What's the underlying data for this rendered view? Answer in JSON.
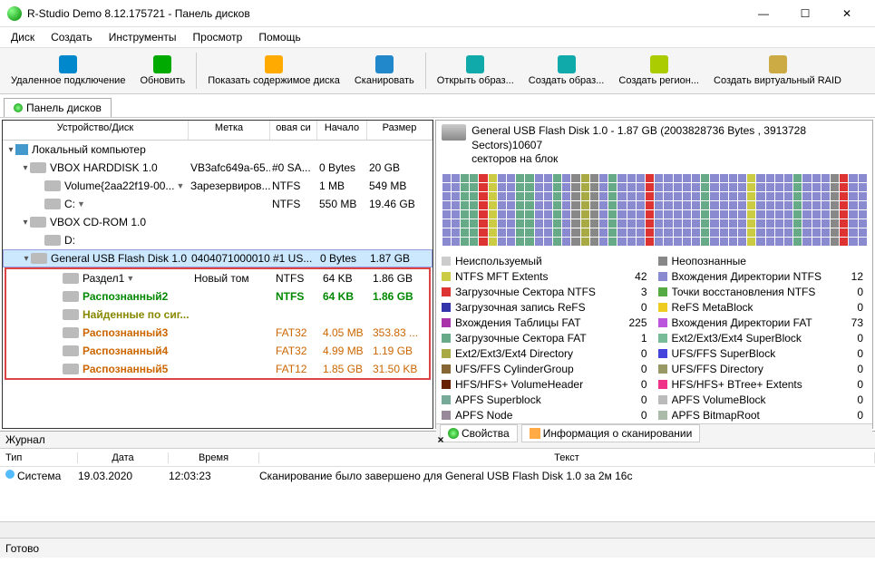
{
  "title": "R-Studio Demo 8.12.175721 - Панель дисков",
  "menu": [
    "Диск",
    "Создать",
    "Инструменты",
    "Просмотр",
    "Помощь"
  ],
  "toolbar": [
    {
      "label": "Удаленное подключение",
      "icon": "#08c"
    },
    {
      "label": "Обновить",
      "icon": "#0a0"
    },
    {
      "label": "Показать содержимое диска",
      "icon": "#fa0",
      "sep": true
    },
    {
      "label": "Сканировать",
      "icon": "#28c"
    },
    {
      "label": "Открыть образ...",
      "icon": "#1aa",
      "sep": true
    },
    {
      "label": "Создать образ...",
      "icon": "#1aa"
    },
    {
      "label": "Создать регион...",
      "icon": "#ac0"
    },
    {
      "label": "Создать виртуальный RAID",
      "icon": "#ca4"
    }
  ],
  "tabname": "Панель дисков",
  "cols": {
    "c1": "Устройство/Диск",
    "c2": "Метка",
    "c3": "овая си",
    "c4": "Начало",
    "c5": "Размер"
  },
  "tree": [
    {
      "ind": 0,
      "tri": "open",
      "ico": "comp",
      "name": "Локальный компьютер"
    },
    {
      "ind": 1,
      "tri": "open",
      "ico": "disk",
      "name": "VBOX HARDDISK 1.0",
      "c2": "VB3afc649a-65...",
      "c3": "#0 SA...",
      "c4": "0 Bytes",
      "c5": "20 GB"
    },
    {
      "ind": 2,
      "ico": "disk",
      "name": "Volume{2aa22f19-00...",
      "dd": true,
      "c2": "Зарезервиров...",
      "c3": "NTFS",
      "c4": "1 MB",
      "c5": "549 MB"
    },
    {
      "ind": 2,
      "ico": "disk",
      "name": "C:",
      "dd": true,
      "c3": "NTFS",
      "c4": "550 MB",
      "c5": "19.46 GB"
    },
    {
      "ind": 1,
      "tri": "open",
      "ico": "disk",
      "name": "VBOX CD-ROM 1.0"
    },
    {
      "ind": 2,
      "ico": "disk",
      "name": "D:"
    },
    {
      "ind": 1,
      "tri": "open",
      "ico": "disk",
      "name": "General USB Flash Disk 1.0",
      "sel": true,
      "c2": "0404071000010...",
      "c3": "#1 US...",
      "c4": "0 Bytes",
      "c5": "1.87 GB"
    }
  ],
  "redrows": [
    {
      "ico": "disk",
      "name": "Раздел1",
      "dd": true,
      "c2": "Новый том",
      "c3": "NTFS",
      "c4": "64 KB",
      "c5": "1.86 GB"
    },
    {
      "ico": "disk",
      "name": "Распознанный2",
      "cls": "green",
      "c3": "NTFS",
      "c3cls": "green",
      "c4": "64 KB",
      "c4cls": "green",
      "c5": "1.86 GB",
      "c5cls": "green"
    },
    {
      "ico": "disk",
      "name": "Найденные по сиг...",
      "cls": "olive"
    },
    {
      "ico": "disk",
      "name": "Распознанный3",
      "cls": "orange",
      "c3": "FAT32",
      "c3cls": "orangeval",
      "c4": "4.05 MB",
      "c4cls": "orangeval",
      "c5": "353.83 ...",
      "c5cls": "orangeval"
    },
    {
      "ico": "disk",
      "name": "Распознанный4",
      "cls": "orange",
      "c3": "FAT32",
      "c3cls": "orangeval",
      "c4": "4.99 MB",
      "c4cls": "orangeval",
      "c5": "1.19 GB",
      "c5cls": "orangeval"
    },
    {
      "ico": "disk",
      "name": "Распознанный5",
      "cls": "orange",
      "c3": "FAT12",
      "c3cls": "orangeval",
      "c4": "1.85 GB",
      "c4cls": "orangeval",
      "c5": "31.50 KB",
      "c5cls": "orangeval"
    }
  ],
  "mapinfo": {
    "line1": "General USB Flash Disk 1.0 - 1.87 GB (2003828736 Bytes , 3913728 Sectors)10607",
    "line2": "секторов на блок"
  },
  "mapcolors": [
    "#8a8ad0",
    "#8a8ad0",
    "#6a8",
    "#6a8",
    "#d33",
    "#cc4",
    "#8a8ad0",
    "#8a8ad0",
    "#6a8",
    "#6a8",
    "#8a8ad0",
    "#8a8ad0",
    "#6a8",
    "#8a8ad0",
    "#888",
    "#aa4",
    "#888",
    "#8a8ad0",
    "#6a8",
    "#8a8ad0",
    "#8a8ad0",
    "#8a8ad0",
    "#d33",
    "#8a8ad0",
    "#8a8ad0",
    "#8a8ad0",
    "#8a8ad0",
    "#8a8ad0",
    "#6a8",
    "#8a8ad0",
    "#8a8ad0",
    "#8a8ad0",
    "#8a8ad0",
    "#cc4",
    "#8a8ad0",
    "#8a8ad0",
    "#8a8ad0",
    "#8a8ad0",
    "#6a8",
    "#8a8ad0",
    "#8a8ad0",
    "#8a8ad0",
    "#888",
    "#d33",
    "#8a8ad0",
    "#8a8ad0"
  ],
  "legend1": [
    {
      "sw": "#ccc",
      "name": "Неиспользуемый",
      "cnt": ""
    },
    {
      "sw": "#cc4",
      "name": "NTFS MFT Extents",
      "cnt": "42"
    },
    {
      "sw": "#d33",
      "name": "Загрузочные Сектора NTFS",
      "cnt": "3"
    },
    {
      "sw": "#33a",
      "name": "Загрузочная запись ReFS",
      "cnt": "0"
    },
    {
      "sw": "#a3a",
      "name": "Вхождения Таблицы FAT",
      "cnt": "225"
    },
    {
      "sw": "#6a8",
      "name": "Загрузочные Сектора FAT",
      "cnt": "1"
    },
    {
      "sw": "#aa4",
      "name": "Ext2/Ext3/Ext4 Directory",
      "cnt": "0"
    },
    {
      "sw": "#863",
      "name": "UFS/FFS CylinderGroup",
      "cnt": "0"
    },
    {
      "sw": "#620",
      "name": "HFS/HFS+ VolumeHeader",
      "cnt": "0"
    },
    {
      "sw": "#7a9",
      "name": "APFS Superblock",
      "cnt": "0"
    },
    {
      "sw": "#989",
      "name": "APFS Node",
      "cnt": "0"
    }
  ],
  "legend2": [
    {
      "sw": "#888",
      "name": "Неопознанные",
      "cnt": ""
    },
    {
      "sw": "#8a8ad0",
      "name": "Вхождения Директории NTFS",
      "cnt": "12"
    },
    {
      "sw": "#5a4",
      "name": "Точки восстановления NTFS",
      "cnt": "0"
    },
    {
      "sw": "#ec2",
      "name": "ReFS MetaBlock",
      "cnt": "0"
    },
    {
      "sw": "#b5d",
      "name": "Вхождения Директории FAT",
      "cnt": "73"
    },
    {
      "sw": "#7b9",
      "name": "Ext2/Ext3/Ext4 SuperBlock",
      "cnt": "0"
    },
    {
      "sw": "#44d",
      "name": "UFS/FFS SuperBlock",
      "cnt": "0"
    },
    {
      "sw": "#996",
      "name": "UFS/FFS Directory",
      "cnt": "0"
    },
    {
      "sw": "#e38",
      "name": "HFS/HFS+ BTree+ Extents",
      "cnt": "0"
    },
    {
      "sw": "#bbb",
      "name": "APFS VolumeBlock",
      "cnt": "0"
    },
    {
      "sw": "#aba",
      "name": "APFS BitmapRoot",
      "cnt": "0"
    }
  ],
  "subtabs": {
    "a": "Свойства",
    "b": "Информация о сканировании"
  },
  "journal": {
    "title": "Журнал",
    "cols": {
      "c1": "Тип",
      "c2": "Дата",
      "c3": "Время",
      "c4": "Текст"
    },
    "row": {
      "c1": "Система",
      "c2": "19.03.2020",
      "c3": "12:03:23",
      "c4": "Сканирование было завершено для General USB Flash Disk 1.0 за 2м 16с"
    }
  },
  "status": "Готово"
}
